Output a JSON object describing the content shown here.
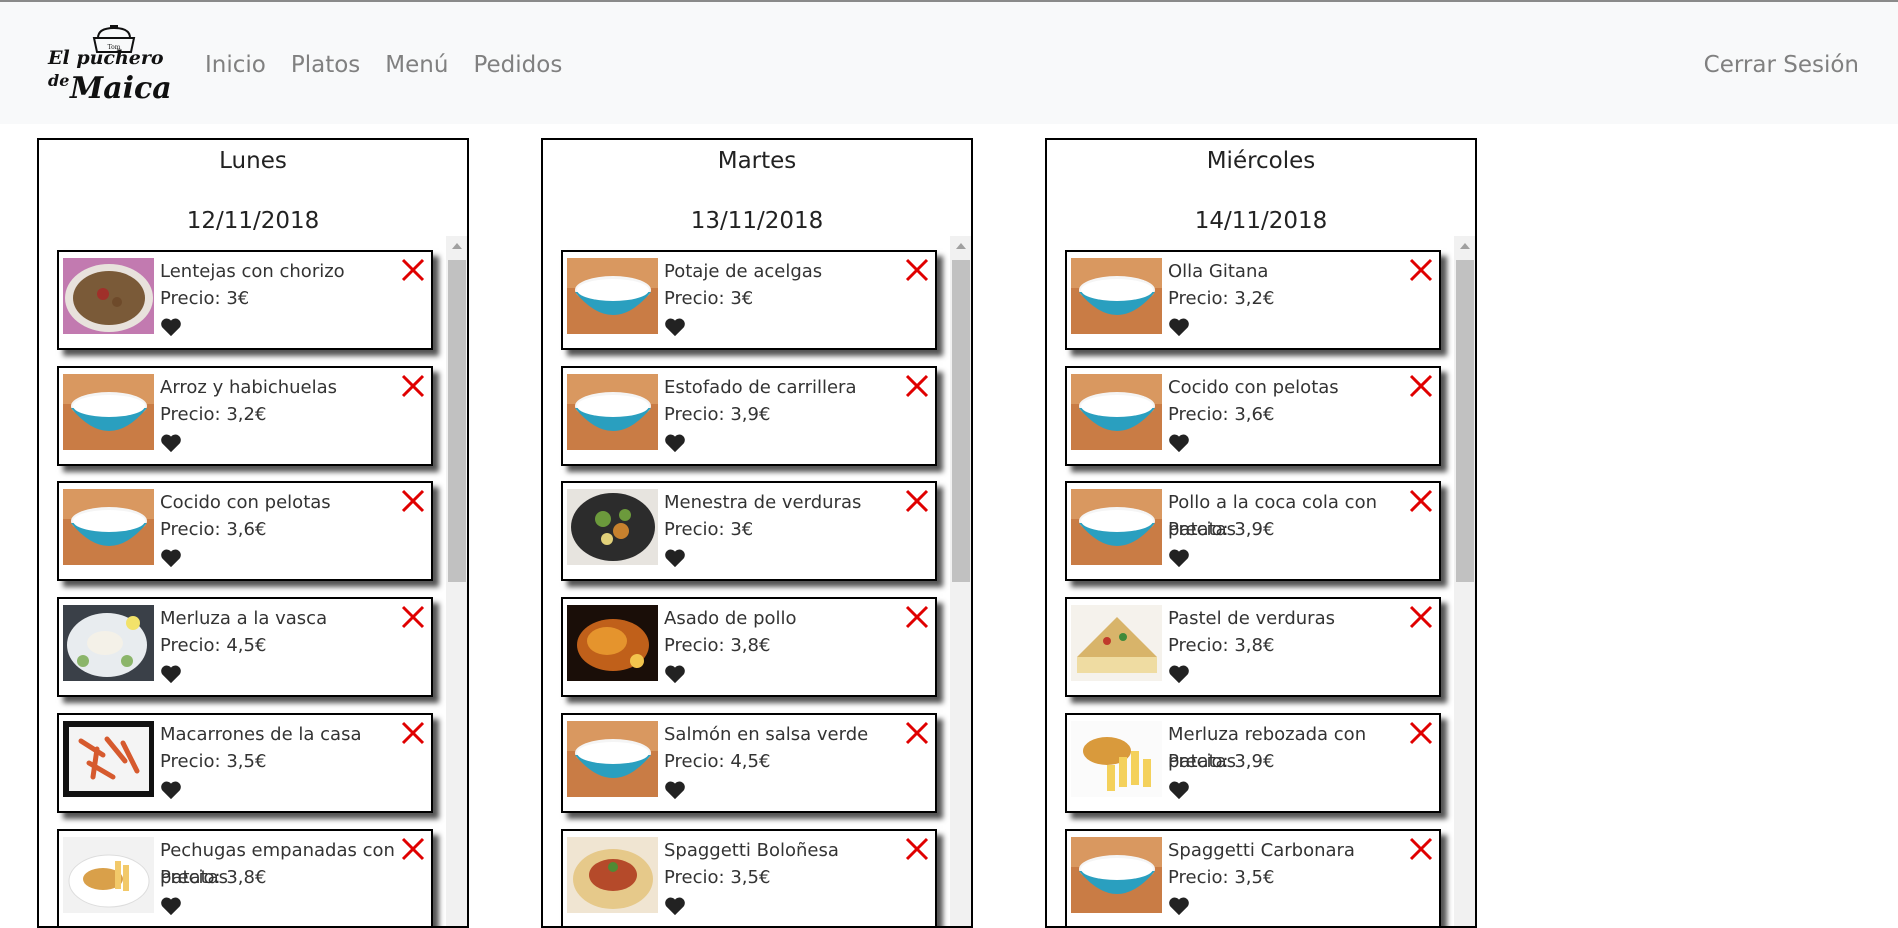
{
  "nav": {
    "logo_text": "El puchero de Maica",
    "links": [
      "Inicio",
      "Platos",
      "Menú",
      "Pedidos"
    ],
    "logout": "Cerrar Sesión"
  },
  "days": [
    {
      "name": "Lunes",
      "date": "12/11/2018",
      "dishes": [
        {
          "name": "Lentejas con chorizo",
          "price": "Precio: 3€",
          "img": "lentils"
        },
        {
          "name": "Arroz y habichuelas",
          "price": "Precio: 3,2€",
          "img": "rice-bowl"
        },
        {
          "name": "Cocido con pelotas",
          "price": "Precio: 3,6€",
          "img": "rice-bowl"
        },
        {
          "name": "Merluza a la vasca",
          "price": "Precio: 4,5€",
          "img": "fish-plate"
        },
        {
          "name": "Macarrones de la casa",
          "price": "Precio: 3,5€",
          "img": "pasta"
        },
        {
          "name": "Pechugas empanadas con patatas",
          "price": "Precio: 3,8€",
          "img": "breaded-chicken"
        }
      ]
    },
    {
      "name": "Martes",
      "date": "13/11/2018",
      "dishes": [
        {
          "name": "Potaje de acelgas",
          "price": "Precio: 3€",
          "img": "rice-bowl"
        },
        {
          "name": "Estofado de carrillera",
          "price": "Precio: 3,9€",
          "img": "rice-bowl"
        },
        {
          "name": "Menestra de verduras",
          "price": "Precio: 3€",
          "img": "vegetables"
        },
        {
          "name": "Asado de pollo",
          "price": "Precio: 3,8€",
          "img": "roast-chicken"
        },
        {
          "name": "Salmón en salsa verde",
          "price": "Precio: 4,5€",
          "img": "rice-bowl"
        },
        {
          "name": "Spaggetti Boloñesa",
          "price": "Precio: 3,5€",
          "img": "bolognese"
        }
      ]
    },
    {
      "name": "Miércoles",
      "date": "14/11/2018",
      "dishes": [
        {
          "name": "Olla Gitana",
          "price": "Precio: 3,2€",
          "img": "rice-bowl"
        },
        {
          "name": "Cocido con pelotas",
          "price": "Precio: 3,6€",
          "img": "rice-bowl"
        },
        {
          "name": "Pollo a la coca cola con patatas",
          "price": "Precio: 3,9€",
          "img": "rice-bowl"
        },
        {
          "name": "Pastel de verduras",
          "price": "Precio: 3,8€",
          "img": "veg-pie"
        },
        {
          "name": "Merluza rebozada con patatas",
          "price": "Precio: 3,9€",
          "img": "fried-fish"
        },
        {
          "name": "Spaggetti Carbonara",
          "price": "Precio: 3,5€",
          "img": "rice-bowl"
        }
      ]
    }
  ],
  "colors": {
    "navbar_bg": "#f8f9fa",
    "nav_link": "#808080",
    "close_icon": "#e00000",
    "heart_icon": "#222222"
  }
}
